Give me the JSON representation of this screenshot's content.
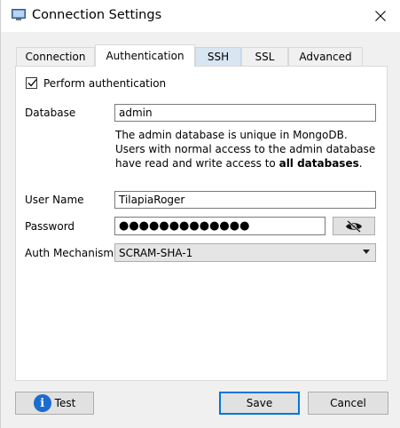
{
  "window": {
    "title": "Connection Settings"
  },
  "tabs": [
    {
      "label": "Connection"
    },
    {
      "label": "Authentication"
    },
    {
      "label": "SSH"
    },
    {
      "label": "SSL"
    },
    {
      "label": "Advanced"
    }
  ],
  "active_tab": "Authentication",
  "auth": {
    "perform_label": "Perform authentication",
    "perform_checked": true,
    "database_label": "Database",
    "database_value": "admin",
    "hint_text": "The admin database is unique in MongoDB. Users with normal access to the admin database have read and write access to ",
    "hint_bold": "all databases",
    "hint_end": ".",
    "username_label": "User Name",
    "username_value": "TilapiaRoger",
    "password_label": "Password",
    "password_value": "●●●●●●●●●●●●●",
    "mechanism_label": "Auth Mechanism",
    "mechanism_value": "SCRAM-SHA-1"
  },
  "footer": {
    "test_label": "Test",
    "save_label": "Save",
    "cancel_label": "Cancel"
  },
  "icons": {
    "app": "computer-monitor-icon",
    "close": "close-icon",
    "reveal_password": "eye-hidden-icon",
    "dropdown": "chevron-down-icon",
    "test": "info-icon"
  },
  "colors": {
    "accent": "#0078d7",
    "info": "#1a6dcf",
    "tab_hover": "#d8e6f2"
  }
}
